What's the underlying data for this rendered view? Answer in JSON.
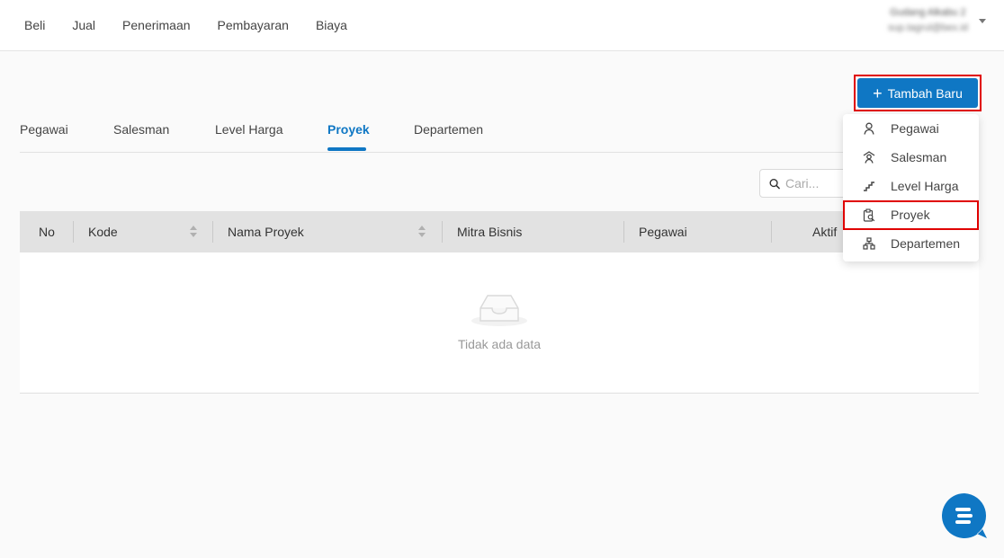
{
  "topnav": {
    "items": [
      "Beli",
      "Jual",
      "Penerimaan",
      "Pembayaran",
      "Biaya"
    ]
  },
  "user": {
    "name": "Gudang Alkabu 2",
    "email": "sup.tagrul@bex.id"
  },
  "toolbar": {
    "add_label": "Tambah Baru"
  },
  "tabs": [
    "Pegawai",
    "Salesman",
    "Level Harga",
    "Proyek",
    "Departemen"
  ],
  "active_tab": "Proyek",
  "search": {
    "placeholder": "Cari..."
  },
  "table": {
    "columns": [
      "No",
      "Kode",
      "Nama Proyek",
      "Mitra Bisnis",
      "Pegawai",
      "Aktif"
    ],
    "empty_text": "Tidak ada data"
  },
  "dropdown": {
    "items": [
      {
        "label": "Pegawai",
        "icon": "user-icon"
      },
      {
        "label": "Salesman",
        "icon": "salesman-icon"
      },
      {
        "label": "Level Harga",
        "icon": "stairs-icon"
      },
      {
        "label": "Proyek",
        "icon": "project-clipboard-icon"
      },
      {
        "label": "Departemen",
        "icon": "org-chart-icon"
      }
    ],
    "highlighted": "Proyek"
  },
  "colors": {
    "primary": "#0f77c4",
    "highlight_frame": "#e00000",
    "table_header_bg": "#e2e2e2"
  }
}
